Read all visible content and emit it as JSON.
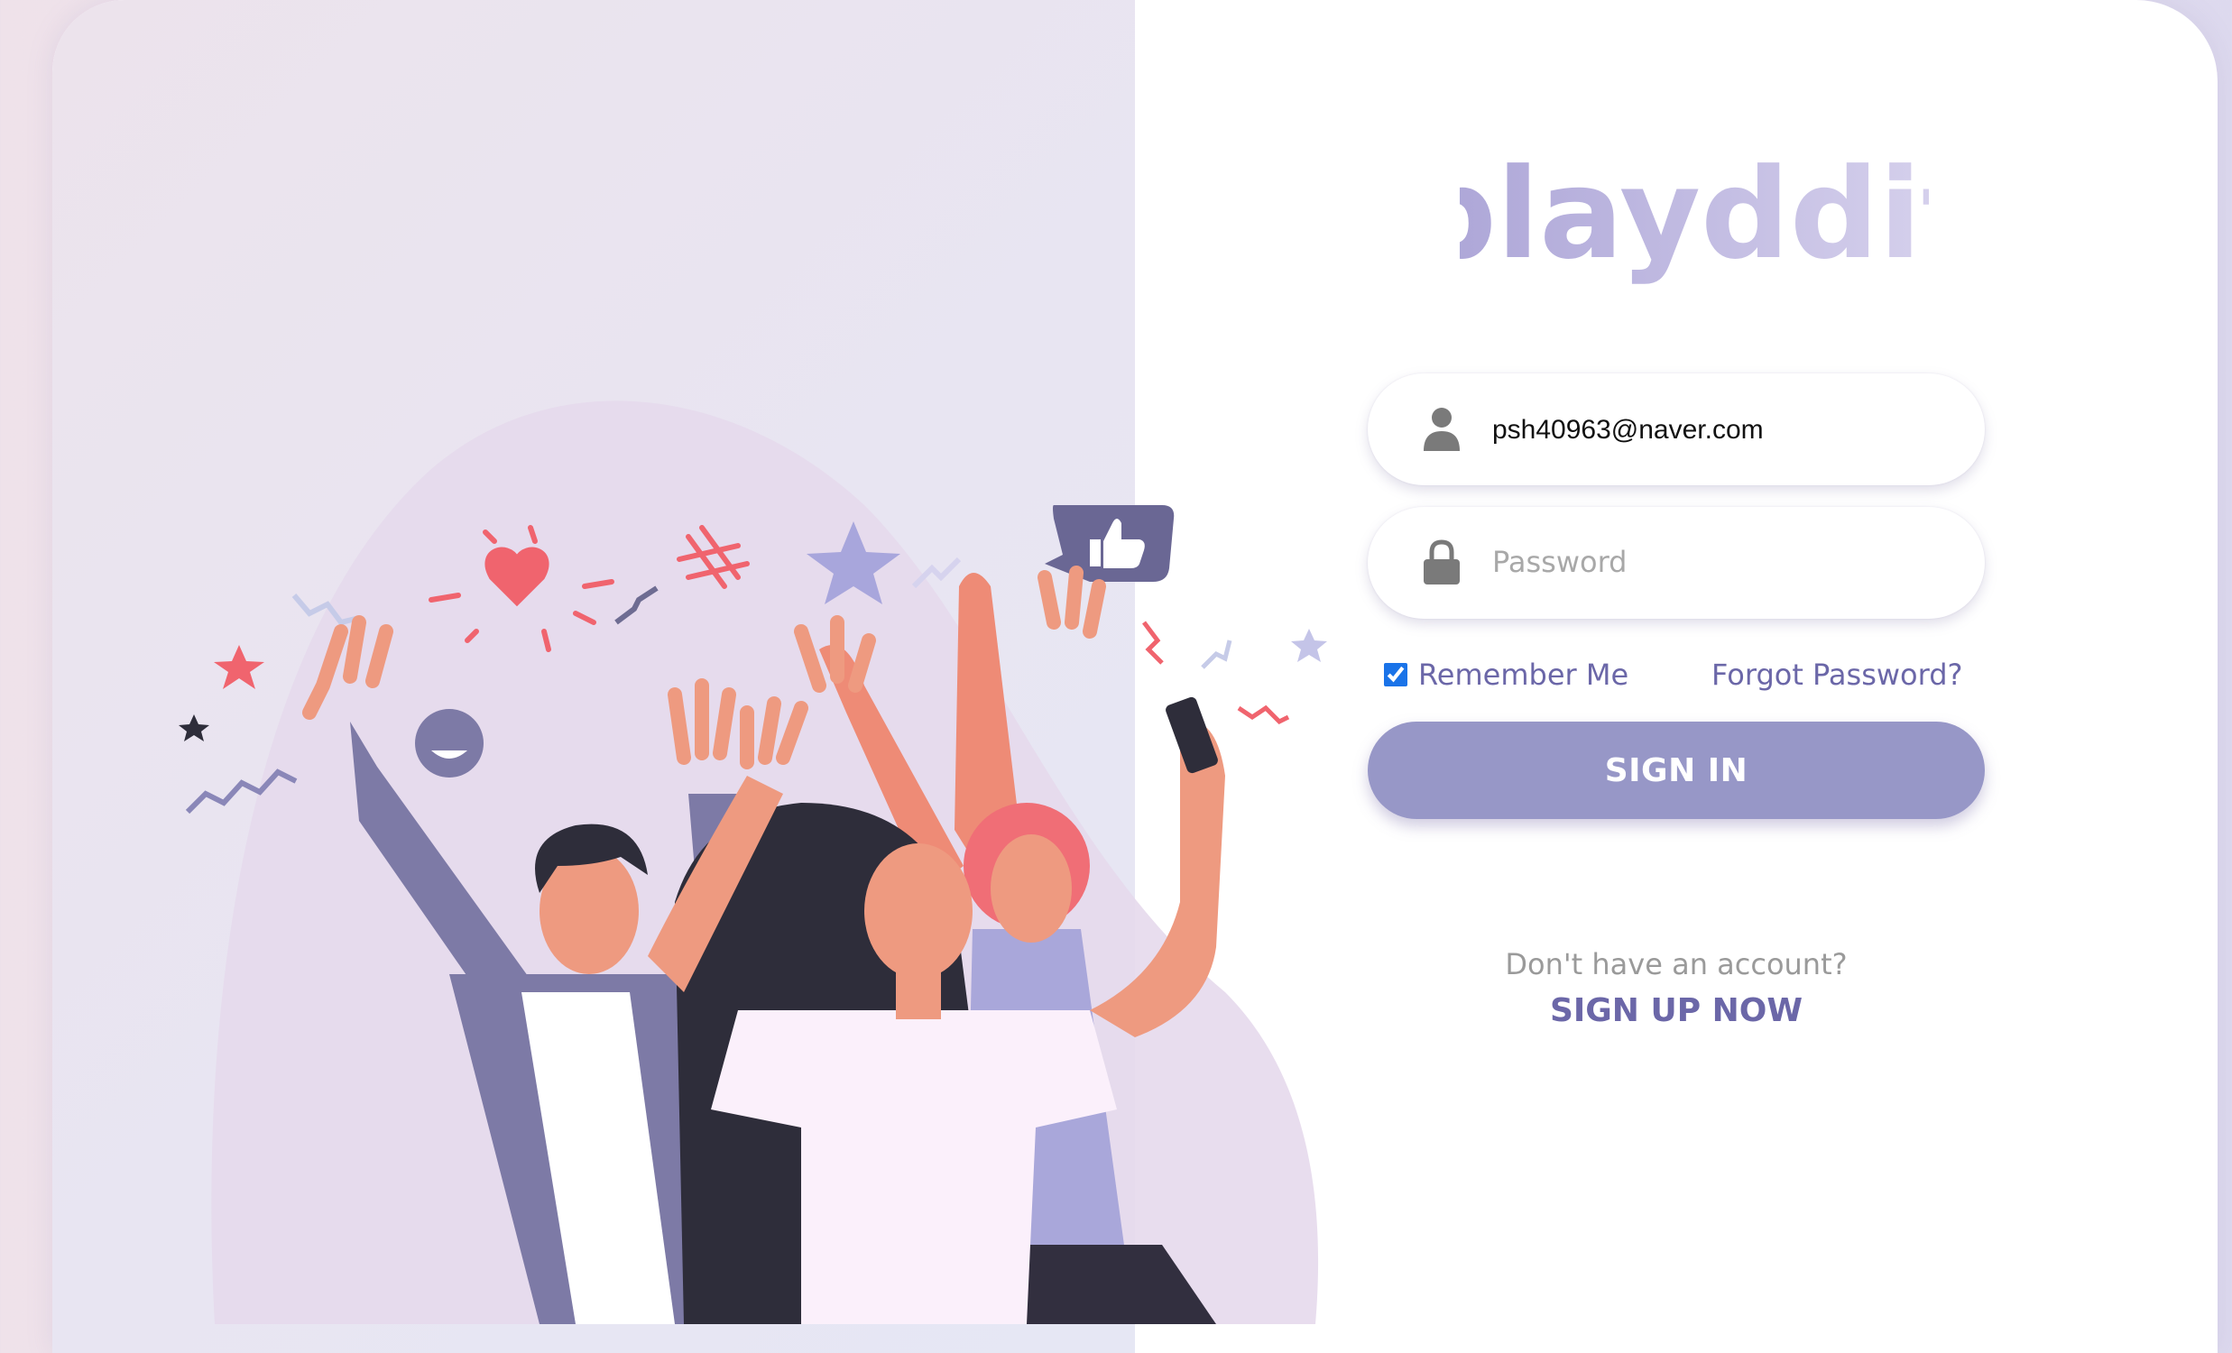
{
  "brand": {
    "logo_text": "playddit",
    "logo_color": "#b9b2dc"
  },
  "login": {
    "email_value": "psh40963@naver.com",
    "password_placeholder": "Password",
    "remember_label": "Remember Me",
    "remember_checked": true,
    "forgot_label": "Forgot Password?",
    "signin_label": "SIGN IN"
  },
  "signup": {
    "prompt": "Don't have an account?",
    "link_label": "SIGN UP NOW"
  },
  "icons": {
    "email": "user-icon",
    "password": "lock-icon"
  },
  "colors": {
    "accent": "#9797c7",
    "link": "#6b67a8",
    "muted": "#9a9a9a"
  }
}
